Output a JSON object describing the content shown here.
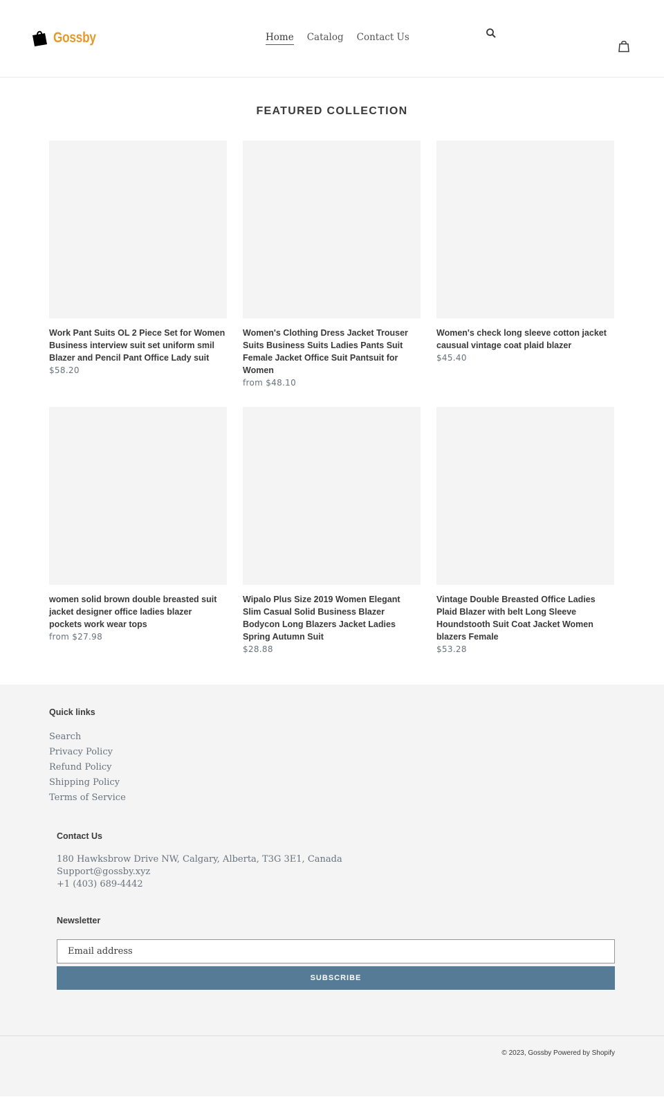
{
  "header": {
    "brand": "Gossby",
    "brand_color": "#e39a2b",
    "nav": [
      {
        "label": "Home",
        "active": true
      },
      {
        "label": "Catalog",
        "active": false
      },
      {
        "label": "Contact Us",
        "active": false
      }
    ],
    "icons": {
      "search": "search-icon",
      "cart": "cart-icon"
    }
  },
  "featured": {
    "title": "FEATURED COLLECTION",
    "products": [
      {
        "title": "Work Pant Suits OL 2 Piece Set for Women Business interview suit set uniform smil Blazer and Pencil Pant Office Lady suit",
        "price": "$58.20"
      },
      {
        "title": "Women's Clothing Dress Jacket Trouser Suits Business Suits Ladies Pants Suit Female Jacket Office Suit Pantsuit for Women",
        "price": "from $48.10"
      },
      {
        "title": "Women's check long sleeve cotton jacket causual vintage coat plaid blazer",
        "price": "$45.40"
      },
      {
        "title": "women solid brown double breasted suit jacket designer office ladies blazer pockets work wear tops",
        "price": "from $27.98"
      },
      {
        "title": "Wipalo Plus Size 2019 Women Elegant Slim Casual Solid Business Blazer Bodycon Long Blazers Jacket Ladies Spring Autumn Suit",
        "price": "$28.88"
      },
      {
        "title": "Vintage Double Breasted Office Ladies Plaid Blazer with belt Long Sleeve Houndstooth Suit Coat Jacket Women blazers Female",
        "price": "$53.28"
      }
    ]
  },
  "footer": {
    "quick_links": {
      "title": "Quick links",
      "items": [
        "Search",
        "Privacy Policy",
        "Refund Policy",
        "Shipping Policy",
        "Terms of Service"
      ]
    },
    "contact": {
      "title": "Contact Us",
      "address": "180 Hawksbrow Drive NW, Calgary, Alberta, T3G 3E1, Canada",
      "email": "Support@gossby.xyz",
      "phone": "+1 (403) 689-4442"
    },
    "newsletter": {
      "title": "Newsletter",
      "placeholder": "Email address",
      "button": "SUBSCRIBE",
      "button_color": "#557b97"
    },
    "copyright": "© 2023, Gossby Powered by Shopify"
  }
}
